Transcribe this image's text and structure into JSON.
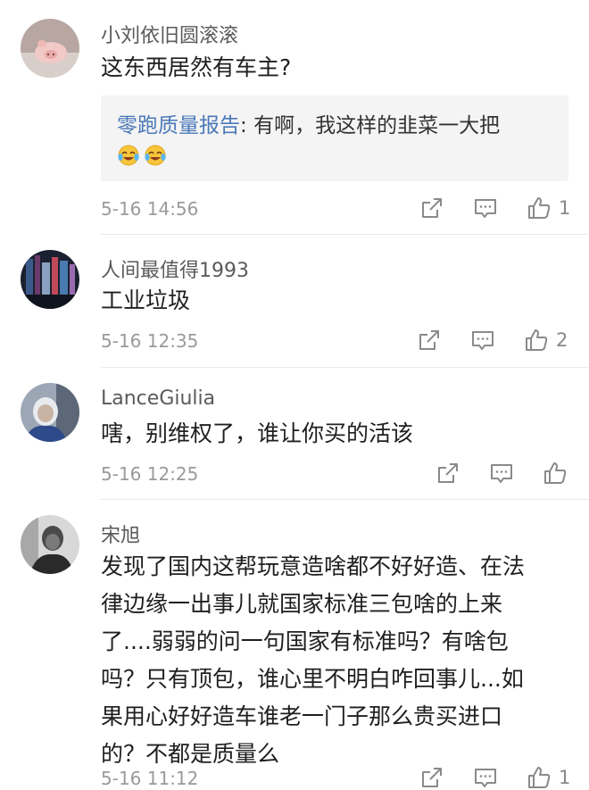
{
  "comments": [
    {
      "username": "小刘依旧圆滚滚",
      "text": "这东西居然有车主?",
      "reply": {
        "author": "零跑质量报告",
        "separator": ": ",
        "text": "有啊，我这样的韭菜一大把",
        "emojis": [
          "crying-laughing-emoji",
          "crying-laughing-emoji"
        ]
      },
      "time": "5-16 14:56",
      "likes": "1"
    },
    {
      "username": "人间最值得1993",
      "text": "工业垃圾",
      "time": "5-16 12:35",
      "likes": "2"
    },
    {
      "username": "LanceGiulia",
      "text": "嗐，别维权了，谁让你买的活该",
      "time": "5-16 12:25",
      "likes": ""
    },
    {
      "username": "宋旭",
      "text_lines": [
        "发现了国内这帮玩意造啥都不好好造、在法",
        "律边缘一出事儿就国家标准三包啥的上来",
        "了....弱弱的问一句国家有标准吗？有啥包",
        "吗？只有顶包，谁心里不明白咋回事儿...如",
        "果用心好好造车谁老一门子那么贵买进口",
        "的？不都是质量么"
      ],
      "time": "5-16 11:12",
      "likes": "1"
    }
  ],
  "icons": {
    "share": "share-icon",
    "comment": "comment-icon",
    "like": "thumbs-up-icon"
  },
  "colors": {
    "reply_author": "#4a78b8",
    "meta": "#9a9a9a",
    "icon": "#8a8a8a"
  }
}
